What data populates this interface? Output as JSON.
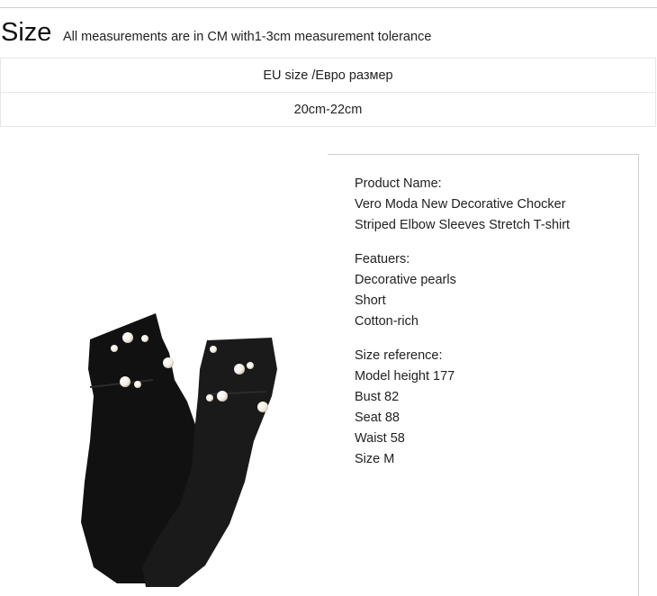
{
  "header": {
    "title": "Size",
    "note": "All measurements are in CM with1-3cm measurement tolerance"
  },
  "size_table": {
    "header": "EU size /Евро размер",
    "value": "20cm-22cm"
  },
  "product": {
    "name_label": "Product Name:",
    "name_line1": "Vero Moda New Decorative Chocker",
    "name_line2": "Striped Elbow Sleeves Stretch T-shirt",
    "features_label": "Featuers:",
    "features": [
      "Decorative pearls",
      "Short",
      "Cotton-rich"
    ],
    "size_ref_label": "Size reference:",
    "size_ref": [
      "Model height 177",
      "Bust 82",
      "Seat 88",
      "Waist 58",
      "Size M"
    ]
  },
  "colors": {
    "sock": "#111111",
    "pearl": "#f4efe4",
    "border": "#e6e6e6"
  }
}
